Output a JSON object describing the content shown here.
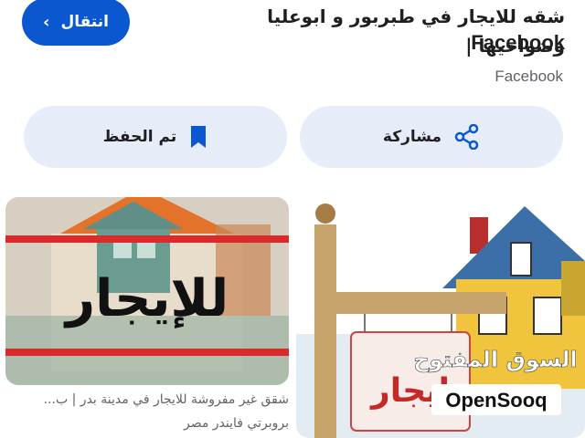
{
  "header": {
    "go_button_label": "انتقال",
    "title_line1": "شقه للايجار في طبربور و ابوعليا وضواحيها |",
    "title_line2": "Facebook",
    "source": "Facebook"
  },
  "actions": {
    "saved_label": "تم الحفظ",
    "share_label": "مشاركة"
  },
  "images": {
    "left_sign_text": "للإيجار",
    "right_sign_text": "ايجار",
    "watermark_arabic": "السوق المفتوح",
    "watermark_latin": "OpenSooq"
  },
  "captions": {
    "line1": "شقق غير مفروشة للايجار في مدينة بدر | ب...",
    "line2": "بروبرتي فايندر مصر"
  },
  "colors": {
    "primary": "#0b57d0",
    "pill_bg": "#e6edf9",
    "text_secondary": "#5f6368"
  }
}
